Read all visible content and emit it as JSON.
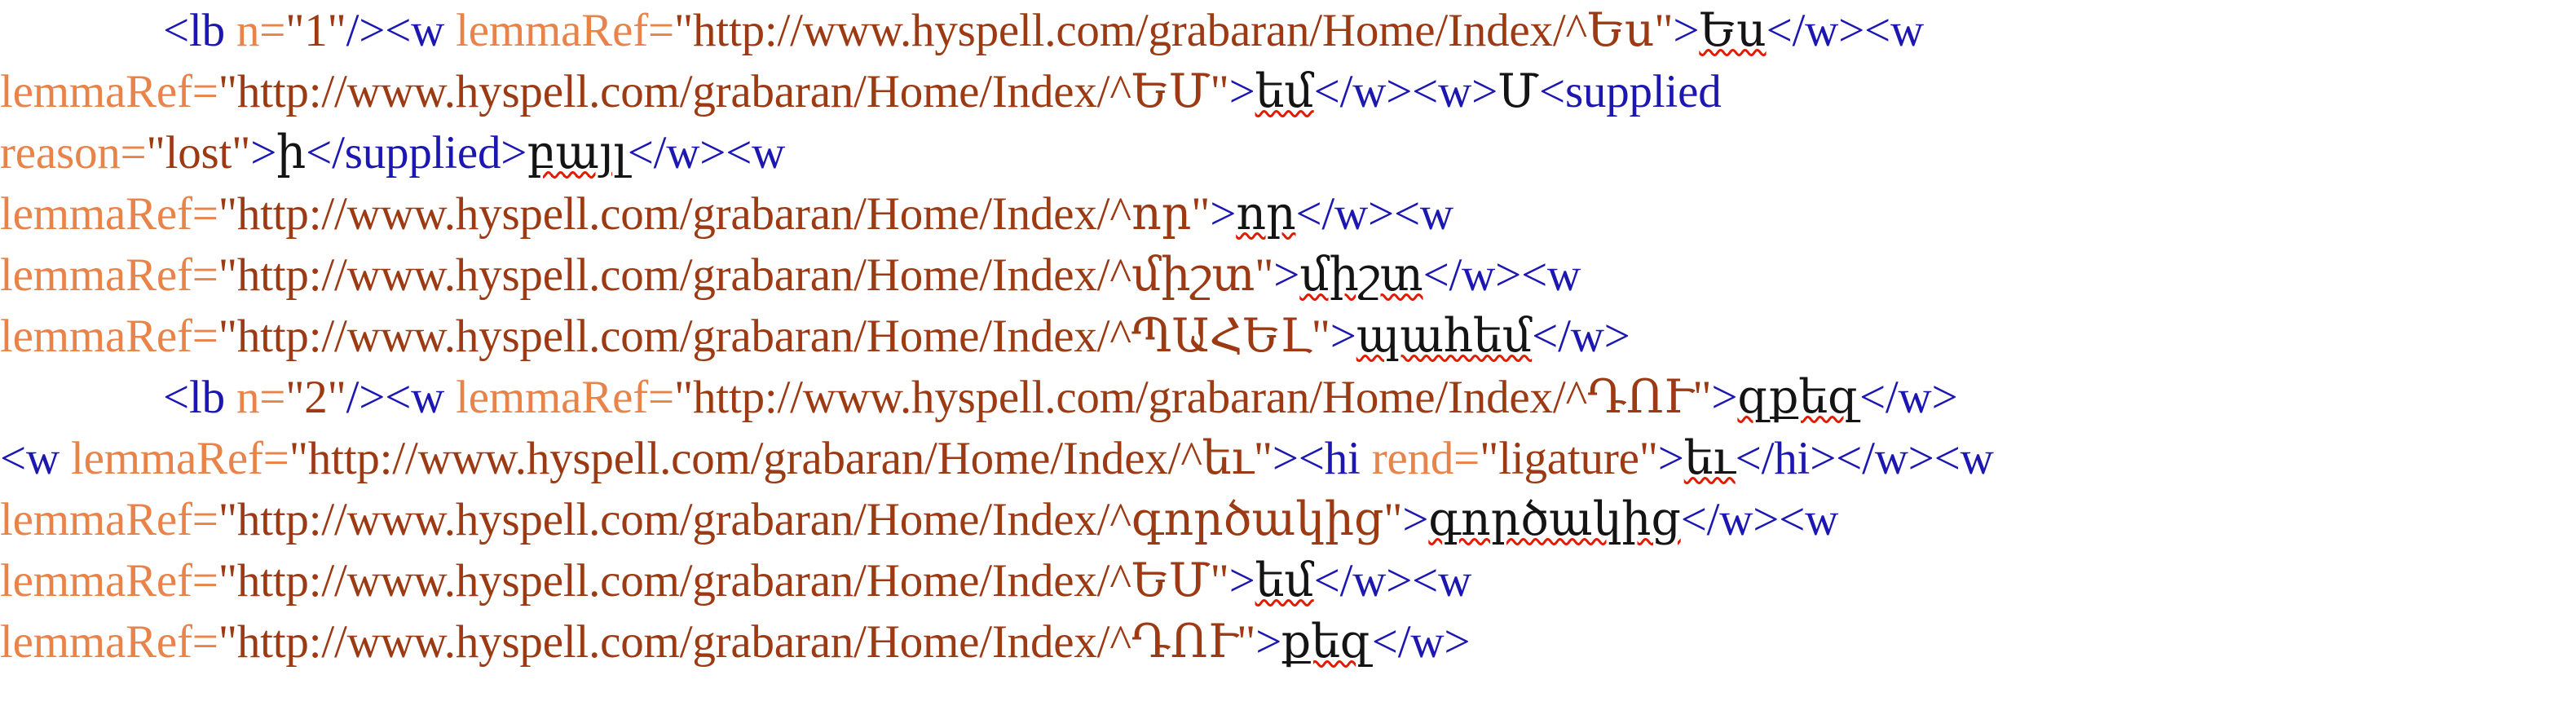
{
  "document": {
    "type": "xml-source-view",
    "syntax_colors": {
      "tag": "#1c17b0",
      "attribute_name": "#e8834a",
      "attribute_value": "#9c3a14",
      "text_content": "#141414",
      "spellcheck_underline": "#e01b00",
      "background": "#ffffff"
    },
    "base_url": "http://www.hyspell.com/grabaran/Home/Index/",
    "lines": [
      {
        "number": 1,
        "indented": true,
        "tokens": [
          {
            "type": "tag",
            "text": "<lb "
          },
          {
            "type": "attr",
            "text": "n="
          },
          {
            "type": "val",
            "text": "\"1\""
          },
          {
            "type": "tag",
            "text": "/><w "
          },
          {
            "type": "attr",
            "text": "lemmaRef="
          },
          {
            "type": "val",
            "text": "\"http://www.hyspell.com/grabaran/Home/Index/^Ես\""
          },
          {
            "type": "tag",
            "text": ">"
          },
          {
            "type": "text",
            "text": "Ես",
            "spell": true
          },
          {
            "type": "tag",
            "text": "</w><w"
          }
        ]
      },
      {
        "number": 2,
        "indented": false,
        "tokens": [
          {
            "type": "attr",
            "text": "lemmaRef="
          },
          {
            "type": "val",
            "text": "\"http://www.hyspell.com/grabaran/Home/Index/^ԵՄ\""
          },
          {
            "type": "tag",
            "text": ">"
          },
          {
            "type": "text",
            "text": "եմ",
            "spell": true
          },
          {
            "type": "tag",
            "text": "</w><w>"
          },
          {
            "type": "text",
            "text": "Մ"
          },
          {
            "type": "tag",
            "text": "<supplied"
          }
        ]
      },
      {
        "number": 3,
        "indented": false,
        "tokens": [
          {
            "type": "attr",
            "text": "reason="
          },
          {
            "type": "val",
            "text": "\"lost\""
          },
          {
            "type": "tag",
            "text": ">"
          },
          {
            "type": "text",
            "text": "ի"
          },
          {
            "type": "tag",
            "text": "</supplied>"
          },
          {
            "type": "text",
            "text": "բայլ",
            "spell": true
          },
          {
            "type": "tag",
            "text": "</w><w"
          }
        ]
      },
      {
        "number": 4,
        "indented": false,
        "tokens": [
          {
            "type": "attr",
            "text": "lemmaRef="
          },
          {
            "type": "val",
            "text": "\"http://www.hyspell.com/grabaran/Home/Index/^որ\""
          },
          {
            "type": "tag",
            "text": ">"
          },
          {
            "type": "text",
            "text": "որ",
            "spell": true
          },
          {
            "type": "tag",
            "text": "</w><w"
          }
        ]
      },
      {
        "number": 5,
        "indented": false,
        "tokens": [
          {
            "type": "attr",
            "text": "lemmaRef="
          },
          {
            "type": "val",
            "text": "\"http://www.hyspell.com/grabaran/Home/Index/^միշտ\""
          },
          {
            "type": "tag",
            "text": ">"
          },
          {
            "type": "text",
            "text": "միշտ",
            "spell": true
          },
          {
            "type": "tag",
            "text": "</w><w"
          }
        ]
      },
      {
        "number": 6,
        "indented": false,
        "tokens": [
          {
            "type": "attr",
            "text": "lemmaRef="
          },
          {
            "type": "val",
            "text": "\"http://www.hyspell.com/grabaran/Home/Index/^ՊԱՀԵԼ\""
          },
          {
            "type": "tag",
            "text": ">"
          },
          {
            "type": "text",
            "text": "պահեմ",
            "spell": true
          },
          {
            "type": "tag",
            "text": "</w>"
          }
        ]
      },
      {
        "number": 7,
        "indented": true,
        "tokens": [
          {
            "type": "tag",
            "text": "<lb "
          },
          {
            "type": "attr",
            "text": "n="
          },
          {
            "type": "val",
            "text": "\"2\""
          },
          {
            "type": "tag",
            "text": "/><w "
          },
          {
            "type": "attr",
            "text": "lemmaRef="
          },
          {
            "type": "val",
            "text": "\"http://www.hyspell.com/grabaran/Home/Index/^ԴՈՒ\""
          },
          {
            "type": "tag",
            "text": ">"
          },
          {
            "type": "text",
            "text": "զքեզ",
            "spell": true
          },
          {
            "type": "tag",
            "text": "</w>"
          }
        ]
      },
      {
        "number": 8,
        "indented": false,
        "tokens": [
          {
            "type": "tag",
            "text": "<w "
          },
          {
            "type": "attr",
            "text": "lemmaRef="
          },
          {
            "type": "val",
            "text": "\"http://www.hyspell.com/grabaran/Home/Index/^եւ\""
          },
          {
            "type": "tag",
            "text": "><hi "
          },
          {
            "type": "attr",
            "text": "rend="
          },
          {
            "type": "val",
            "text": "\"ligature\""
          },
          {
            "type": "tag",
            "text": ">"
          },
          {
            "type": "text",
            "text": "եւ",
            "spell": true
          },
          {
            "type": "tag",
            "text": "</hi></w><w"
          }
        ]
      },
      {
        "number": 9,
        "indented": false,
        "tokens": [
          {
            "type": "attr",
            "text": "lemmaRef="
          },
          {
            "type": "val",
            "text": "\"http://www.hyspell.com/grabaran/Home/Index/^գործակից\""
          },
          {
            "type": "tag",
            "text": ">"
          },
          {
            "type": "text",
            "text": "գործակից",
            "spell": true
          },
          {
            "type": "tag",
            "text": "</w><w"
          }
        ]
      },
      {
        "number": 10,
        "indented": false,
        "tokens": [
          {
            "type": "attr",
            "text": "lemmaRef="
          },
          {
            "type": "val",
            "text": "\"http://www.hyspell.com/grabaran/Home/Index/^ԵՄ\""
          },
          {
            "type": "tag",
            "text": ">"
          },
          {
            "type": "text",
            "text": "եմ",
            "spell": true
          },
          {
            "type": "tag",
            "text": "</w><w"
          }
        ]
      },
      {
        "number": 11,
        "indented": false,
        "tokens": [
          {
            "type": "attr",
            "text": "lemmaRef="
          },
          {
            "type": "val",
            "text": "\"http://www.hyspell.com/grabaran/Home/Index/^ԴՈՒ\""
          },
          {
            "type": "tag",
            "text": ">"
          },
          {
            "type": "text",
            "text": "քեզ",
            "spell": true
          },
          {
            "type": "tag",
            "text": "</w>"
          }
        ]
      }
    ]
  }
}
